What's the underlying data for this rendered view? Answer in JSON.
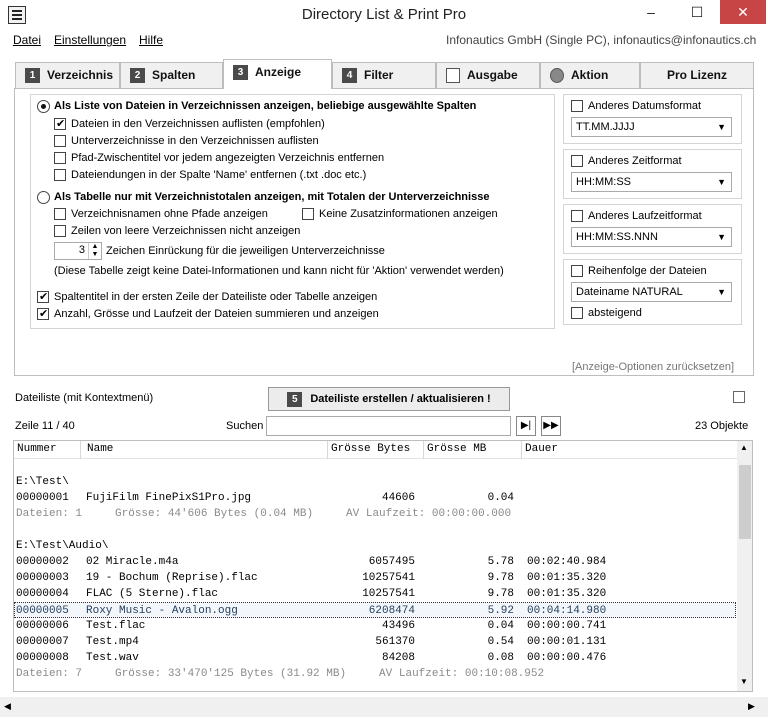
{
  "window": {
    "title": "Directory List & Print Pro",
    "minimize": "–",
    "maximize": "☐",
    "close": "✕"
  },
  "menu": {
    "datei": "Datei",
    "einstellungen": "Einstellungen",
    "hilfe": "Hilfe",
    "company": "Infonautics GmbH (Single PC), infonautics@infonautics.ch"
  },
  "tabs": [
    {
      "num": "1",
      "label": "Verzeichnis"
    },
    {
      "num": "2",
      "label": "Spalten"
    },
    {
      "num": "3",
      "label": "Anzeige"
    },
    {
      "num": "4",
      "label": "Filter"
    },
    {
      "label": "Ausgabe"
    },
    {
      "label": "Aktion"
    },
    {
      "label": "Pro Lizenz"
    }
  ],
  "anzeige": {
    "radio1": "Als Liste von Dateien in Verzeichnissen anzeigen, beliebige ausgewählte Spalten",
    "opt1": "Dateien in den Verzeichnissen auflisten (empfohlen)",
    "opt2": "Unterverzeichnisse in den Verzeichnissen auflisten",
    "opt3": "Pfad-Zwischentitel vor jedem angezeigten Verzeichnis entfernen",
    "opt4": "Dateiendungen in der Spalte 'Name' entfernen (.txt .doc etc.)",
    "radio2": "Als Tabelle nur mit Verzeichnistotalen anzeigen, mit Totalen der Unterverzeichnisse",
    "opt5": "Verzeichnisnamen ohne Pfade anzeigen",
    "opt6": "Keine Zusatzinformationen anzeigen",
    "opt7": "Zeilen von leere Verzeichnissen nicht anzeigen",
    "indent_value": "3",
    "indent_label": "Zeichen Einrückung für die jeweiligen Unterverzeichnisse",
    "note": "(Diese Tabelle zeigt keine Datei-Informationen und kann nicht für 'Aktion' verwendet werden)",
    "opt8": "Spaltentitel in der ersten Zeile der Dateiliste oder Tabelle anzeigen",
    "opt9": "Anzahl, Grösse und Laufzeit der Dateien summieren und anzeigen"
  },
  "right": {
    "date_label": "Anderes Datumsformat",
    "date_value": "TT.MM.JJJJ",
    "time_label": "Anderes Zeitformat",
    "time_value": "HH:MM:SS",
    "duration_label": "Anderes Laufzeitformat",
    "duration_value": "HH:MM:SS.NNN",
    "order_label": "Reihenfolge der Dateien",
    "order_value": "Dateiname NATURAL",
    "desc_label": "absteigend",
    "reset": "[Anzeige-Optionen zurücksetzen]"
  },
  "list": {
    "title": "Dateiliste (mit Kontextmenü)",
    "create_num": "5",
    "create": "Dateiliste erstellen / aktualisieren !",
    "line": "Zeile 11 / 40",
    "search_label": "Suchen",
    "count": "23 Objekte",
    "columns": [
      "Nummer",
      "Name",
      "Grösse Bytes",
      "Grösse MB",
      "Dauer"
    ]
  },
  "rows": [
    {
      "text": "E:\\Test\\"
    },
    {
      "num": "00000001",
      "name": "FujiFilm FinePixS1Pro.jpg",
      "bytes": "44606",
      "mb": "0.04",
      "dur": ""
    },
    {
      "summary": "Dateien: 1     Grösse: 44'606 Bytes (0.04 MB)     AV Laufzeit: 00:00:00.000"
    },
    {
      "text": "E:\\Test\\Audio\\"
    },
    {
      "num": "00000002",
      "name": "02 Miracle.m4a",
      "bytes": "6057495",
      "mb": "5.78",
      "dur": "00:02:40.984"
    },
    {
      "num": "00000003",
      "name": "19 - Bochum (Reprise).flac",
      "bytes": "10257541",
      "mb": "9.78",
      "dur": "00:01:35.320"
    },
    {
      "num": "00000004",
      "name": "FLAC (5 Sterne).flac",
      "bytes": "10257541",
      "mb": "9.78",
      "dur": "00:01:35.320"
    },
    {
      "num": "00000005",
      "name": "Roxy Music - Avalon.ogg",
      "bytes": "6208474",
      "mb": "5.92",
      "dur": "00:04:14.980"
    },
    {
      "num": "00000006",
      "name": "Test.flac",
      "bytes": "43496",
      "mb": "0.04",
      "dur": "00:00:00.741"
    },
    {
      "num": "00000007",
      "name": "Test.mp4",
      "bytes": "561370",
      "mb": "0.54",
      "dur": "00:00:01.131"
    },
    {
      "num": "00000008",
      "name": "Test.wav",
      "bytes": "84208",
      "mb": "0.08",
      "dur": "00:00:00.476"
    },
    {
      "summary": "Dateien: 7     Grösse: 33'470'125 Bytes (31.92 MB)     AV Laufzeit: 00:10:08.952"
    }
  ]
}
